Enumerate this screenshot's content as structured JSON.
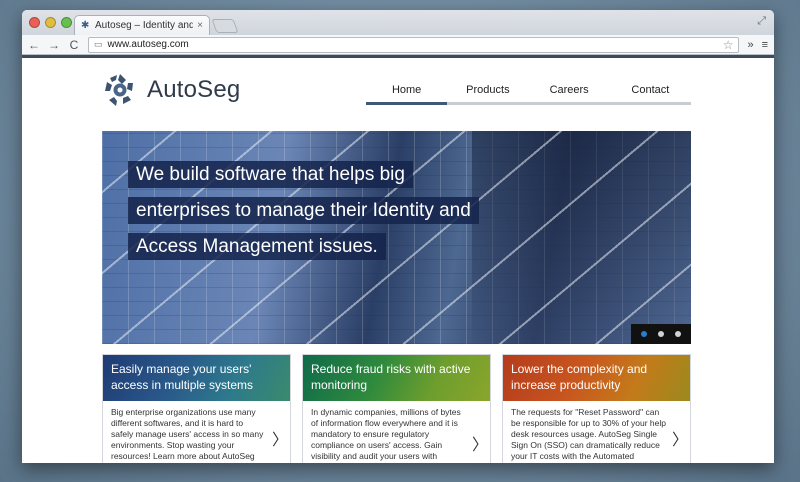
{
  "browser": {
    "tab_title": "Autoseg – Identity and Acc",
    "tab_close": "×",
    "url": "www.autoseg.com",
    "nav_back": "←",
    "nav_forward": "→",
    "nav_reload": "C",
    "star": "☆",
    "extensions": "»",
    "menu": "≡",
    "resize": "⤢"
  },
  "site": {
    "logo_text": "AutoSeg",
    "nav": [
      {
        "label": "Home",
        "active": true
      },
      {
        "label": "Products",
        "active": false
      },
      {
        "label": "Careers",
        "active": false
      },
      {
        "label": "Contact",
        "active": false
      }
    ],
    "hero": {
      "lines": [
        "We build software that helps big",
        "enterprises to manage their Identity and",
        "Access Management issues."
      ],
      "dots": 3,
      "active_dot": 0
    },
    "cards": [
      {
        "title": "Easily manage your users' access in multiple systems",
        "body": "Big enterprise organizations use many different softwares, and it is hard to safely manage users' access in so many environments. Stop wasting your resources! Learn more about AutoSeg Identity and Access Management (IAM).",
        "arrow": "〉",
        "theme": "blue"
      },
      {
        "title": "Reduce fraud risks with active monitoring",
        "body": "In dynamic companies, millions of bytes of information flow everywhere and it is mandatory to ensure regulatory compliance on users' access. Gain visibility and audit your users with AutoSeg Continuous Control Monitoring (CCM).",
        "arrow": "〉",
        "theme": "green"
      },
      {
        "title": "Lower the complexity and increase productivity",
        "body": "The requests for \"Reset Password\" can be responsible for up to 30% of your help desk resources usage. AutoSeg Single Sign On (SSO) can dramatically reduce your IT costs with the Automated Password Reset feature.",
        "arrow": "〉",
        "theme": "orange"
      }
    ]
  }
}
